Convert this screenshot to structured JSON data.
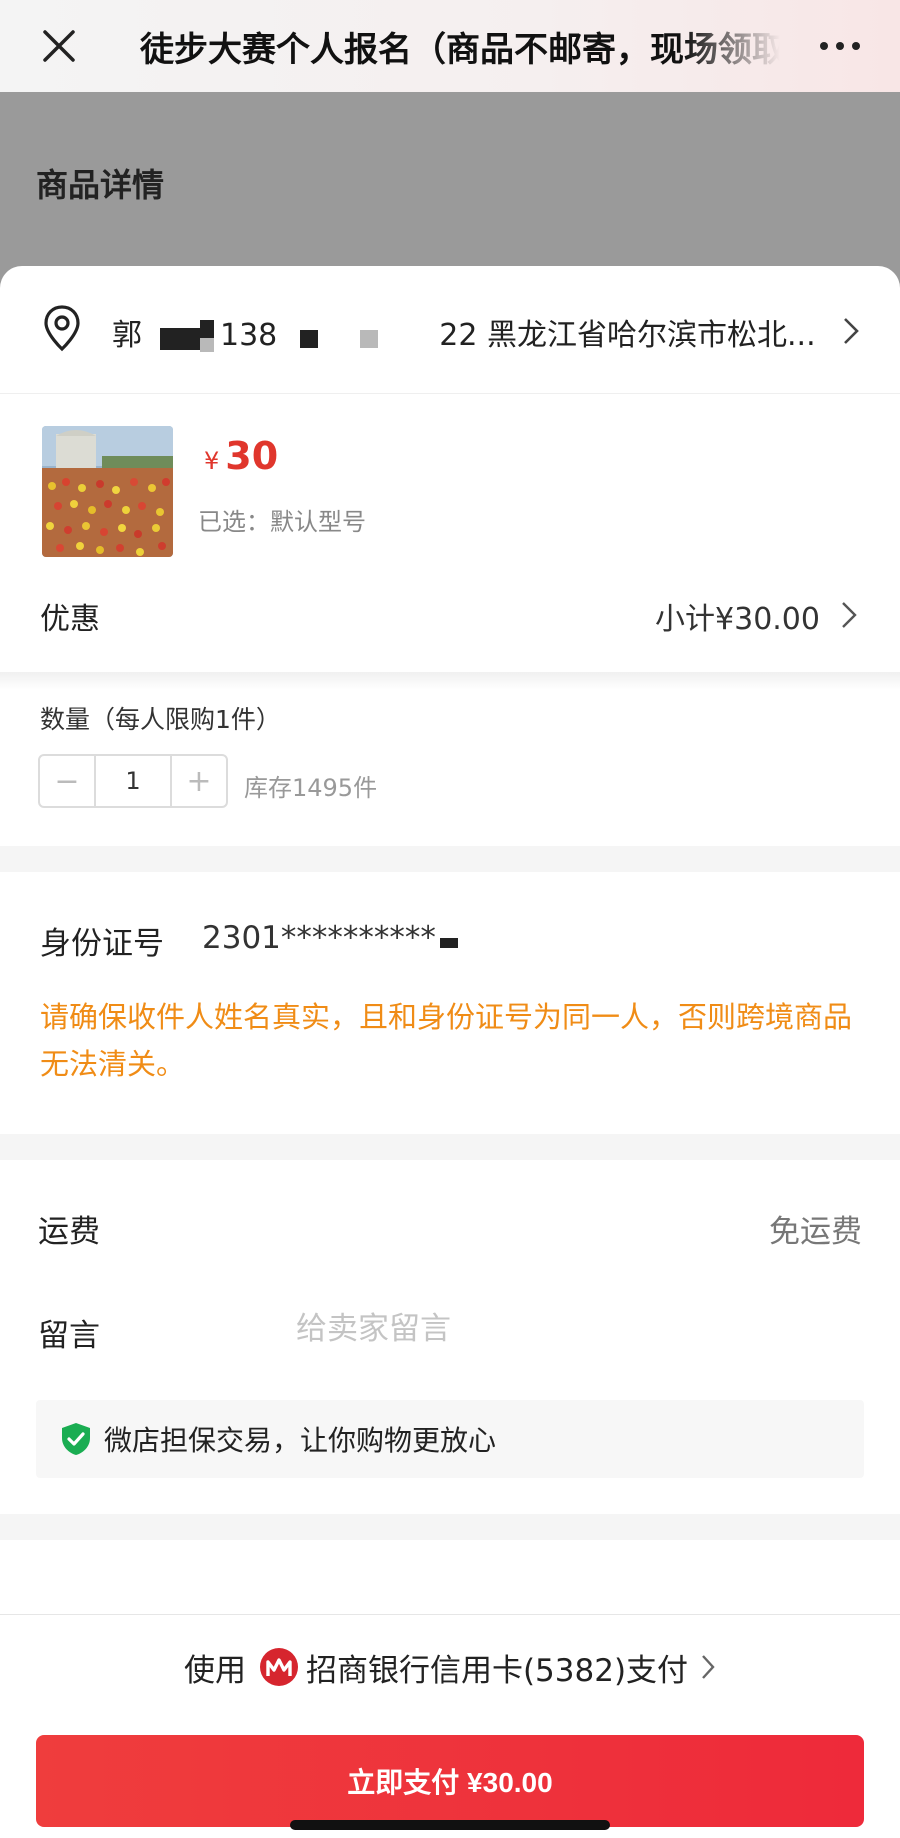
{
  "nav": {
    "title": "徒步大赛个人报名（商品不邮寄，现场领取）",
    "close_icon": "close-icon",
    "more_icon": "more-icon"
  },
  "background": {
    "section_title": "商品详情"
  },
  "address": {
    "name": "郭",
    "phone_prefix": "138",
    "phone_suffix": "22",
    "address_text": "黑龙江省哈尔滨市松北..."
  },
  "product": {
    "currency": "¥",
    "price": "30",
    "spec": "已选：默认型号",
    "promo_label": "优惠",
    "subtotal": "小计¥30.00"
  },
  "quantity": {
    "label": "数量（每人限购1件）",
    "minus": "−",
    "value": "1",
    "plus": "+",
    "stock": "库存1495件"
  },
  "identity": {
    "label": "身份证号",
    "value": "2301**********",
    "warning": "请确保收件人姓名真实，且和身份证号为同一人，否则跨境商品无法清关。"
  },
  "order": {
    "shipping_label": "运费",
    "shipping_value": "免运费",
    "message_label": "留言",
    "message_placeholder": "给卖家留言",
    "guarantee": "微店担保交易，让你购物更放心"
  },
  "payment": {
    "use_label": "使用",
    "method": "招商银行信用卡(5382)支付",
    "pay_button": "立即支付 ¥30.00"
  },
  "colors": {
    "accent_red": "#e0362c",
    "warning_orange": "#f08c16",
    "guarantee_green": "#1aad52"
  }
}
